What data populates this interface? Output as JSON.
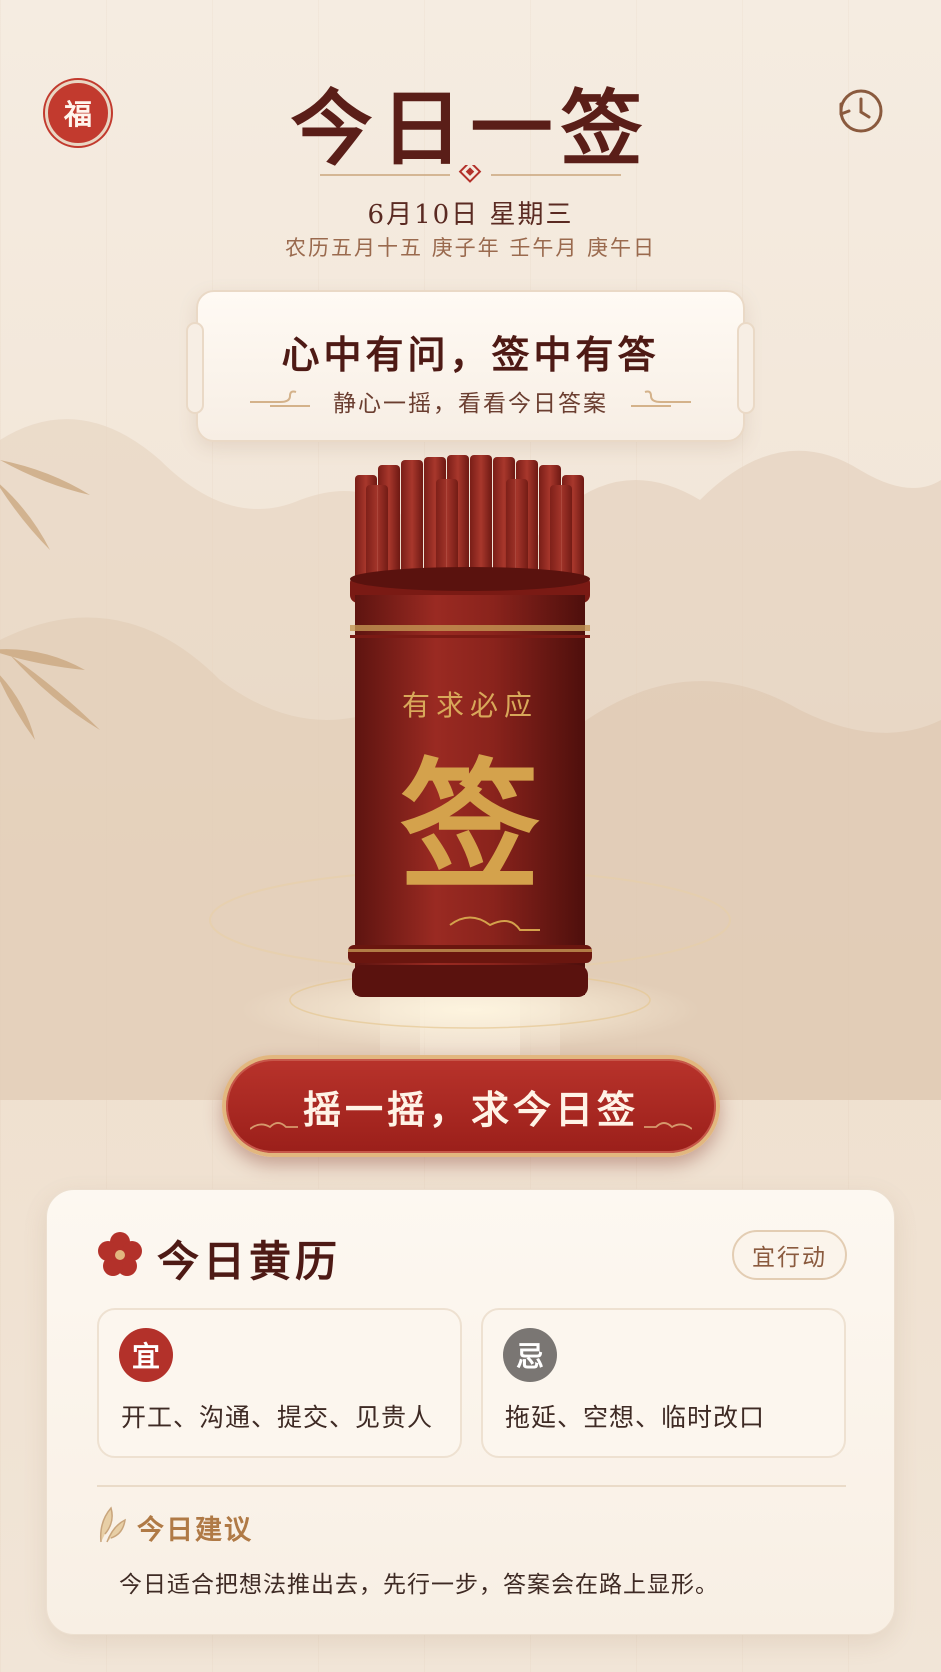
{
  "seal": {
    "char": "福"
  },
  "header": {
    "title": "今日一签",
    "date": "6月10日  星期三",
    "lunar": "农历五月十五  庚子年  壬午月  庚午日"
  },
  "banner": {
    "title": "心中有问，签中有答",
    "subtitle": "静心一摇，看看今日答案"
  },
  "cylinder": {
    "motto": "有求必应",
    "big_char": "签",
    "stick_glyph": "签"
  },
  "action": {
    "shake_label": "摇一摇，求今日签"
  },
  "almanac": {
    "title": "今日黄历",
    "tag": "宜行动",
    "yi": {
      "badge": "宜",
      "items": "开工、沟通、提交、见贵人"
    },
    "ji": {
      "badge": "忌",
      "items": "拖延、空想、临时改口"
    },
    "advice_title": "今日建议",
    "advice_text": "今日适合把想法推出去，先行一步，答案会在路上显形。"
  },
  "colors": {
    "accent_red": "#b3312a",
    "gold": "#d8a85a",
    "background": "#f2e6d8",
    "dark_text": "#4e1a15"
  }
}
